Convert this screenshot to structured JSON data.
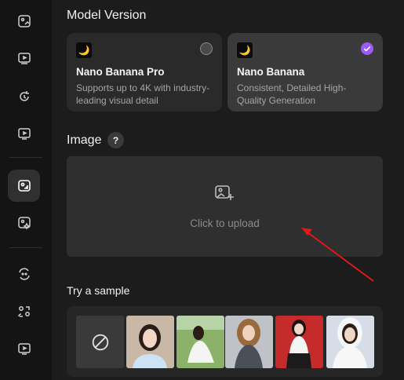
{
  "sidebar": {
    "items": [
      {
        "icon": "image-edit-icon"
      },
      {
        "icon": "video-icon"
      },
      {
        "icon": "refresh-icon"
      },
      {
        "icon": "video-play-icon"
      },
      {
        "icon": "image-generate-icon",
        "active": true
      },
      {
        "icon": "image-sparkle-icon"
      },
      {
        "icon": "face-swap-icon"
      },
      {
        "icon": "people-swap-icon"
      },
      {
        "icon": "video-clip-icon"
      }
    ]
  },
  "model_version": {
    "title": "Model Version",
    "options": [
      {
        "name": "Nano Banana Pro",
        "desc_line1": "Supports up to 4K with industry-",
        "desc_line2": "leading visual detail",
        "selected": false
      },
      {
        "name": "Nano Banana",
        "desc_line1": "Consistent, Detailed High-",
        "desc_line2": "Quality Generation",
        "selected": true
      }
    ]
  },
  "image": {
    "title": "Image",
    "help": "?",
    "upload_text": "Click to upload"
  },
  "samples": {
    "title": "Try a sample",
    "items": [
      {
        "label": "none"
      },
      {
        "label": "woman in white top"
      },
      {
        "label": "woman in grass field"
      },
      {
        "label": "woman in grey top"
      },
      {
        "label": "woman in school uniform"
      },
      {
        "label": "woman in wedding veil"
      }
    ]
  },
  "colors": {
    "accent": "#9b5cf6",
    "arrow": "#e0191b"
  }
}
